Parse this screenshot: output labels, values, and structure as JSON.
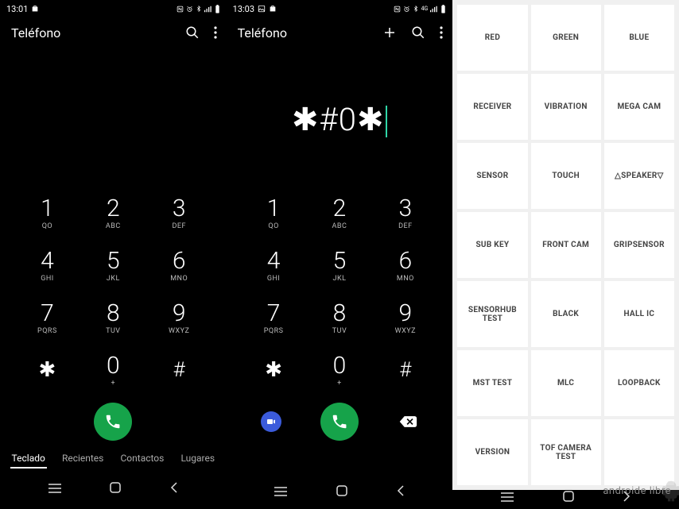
{
  "panel1": {
    "status": {
      "time": "13:01"
    },
    "header": {
      "title": "Teléfono"
    },
    "keypad": [
      {
        "num": "1",
        "sub": "QO"
      },
      {
        "num": "2",
        "sub": "ABC"
      },
      {
        "num": "3",
        "sub": "DEF"
      },
      {
        "num": "4",
        "sub": "GHI"
      },
      {
        "num": "5",
        "sub": "JKL"
      },
      {
        "num": "6",
        "sub": "MNO"
      },
      {
        "num": "7",
        "sub": "PQRS"
      },
      {
        "num": "8",
        "sub": "TUV"
      },
      {
        "num": "9",
        "sub": "WXYZ"
      },
      {
        "num": "✱",
        "sub": ""
      },
      {
        "num": "0",
        "sub": "+"
      },
      {
        "num": "#",
        "sub": ""
      }
    ],
    "tabs": [
      "Teclado",
      "Recientes",
      "Contactos",
      "Lugares"
    ]
  },
  "panel2": {
    "status": {
      "time": "13:03"
    },
    "header": {
      "title": "Teléfono"
    },
    "entered": "✱#0✱",
    "keypad": [
      {
        "num": "1",
        "sub": "QO"
      },
      {
        "num": "2",
        "sub": "ABC"
      },
      {
        "num": "3",
        "sub": "DEF"
      },
      {
        "num": "4",
        "sub": "GHI"
      },
      {
        "num": "5",
        "sub": "JKL"
      },
      {
        "num": "6",
        "sub": "MNO"
      },
      {
        "num": "7",
        "sub": "PQRS"
      },
      {
        "num": "8",
        "sub": "TUV"
      },
      {
        "num": "9",
        "sub": "WXYZ"
      },
      {
        "num": "✱",
        "sub": ""
      },
      {
        "num": "0",
        "sub": "+"
      },
      {
        "num": "#",
        "sub": ""
      }
    ]
  },
  "panel3": {
    "buttons": [
      "RED",
      "GREEN",
      "BLUE",
      "RECEIVER",
      "VIBRATION",
      "MEGA CAM",
      "SENSOR",
      "TOUCH",
      "△SPEAKER▽",
      "SUB KEY",
      "FRONT CAM",
      "GRIPSENSOR",
      "SENSORHUB TEST",
      "BLACK",
      "HALL IC",
      "MST TEST",
      "MLC",
      "LOOPBACK",
      "VERSION",
      "TOF CAMERA TEST",
      ""
    ]
  },
  "watermark": "androide libre"
}
